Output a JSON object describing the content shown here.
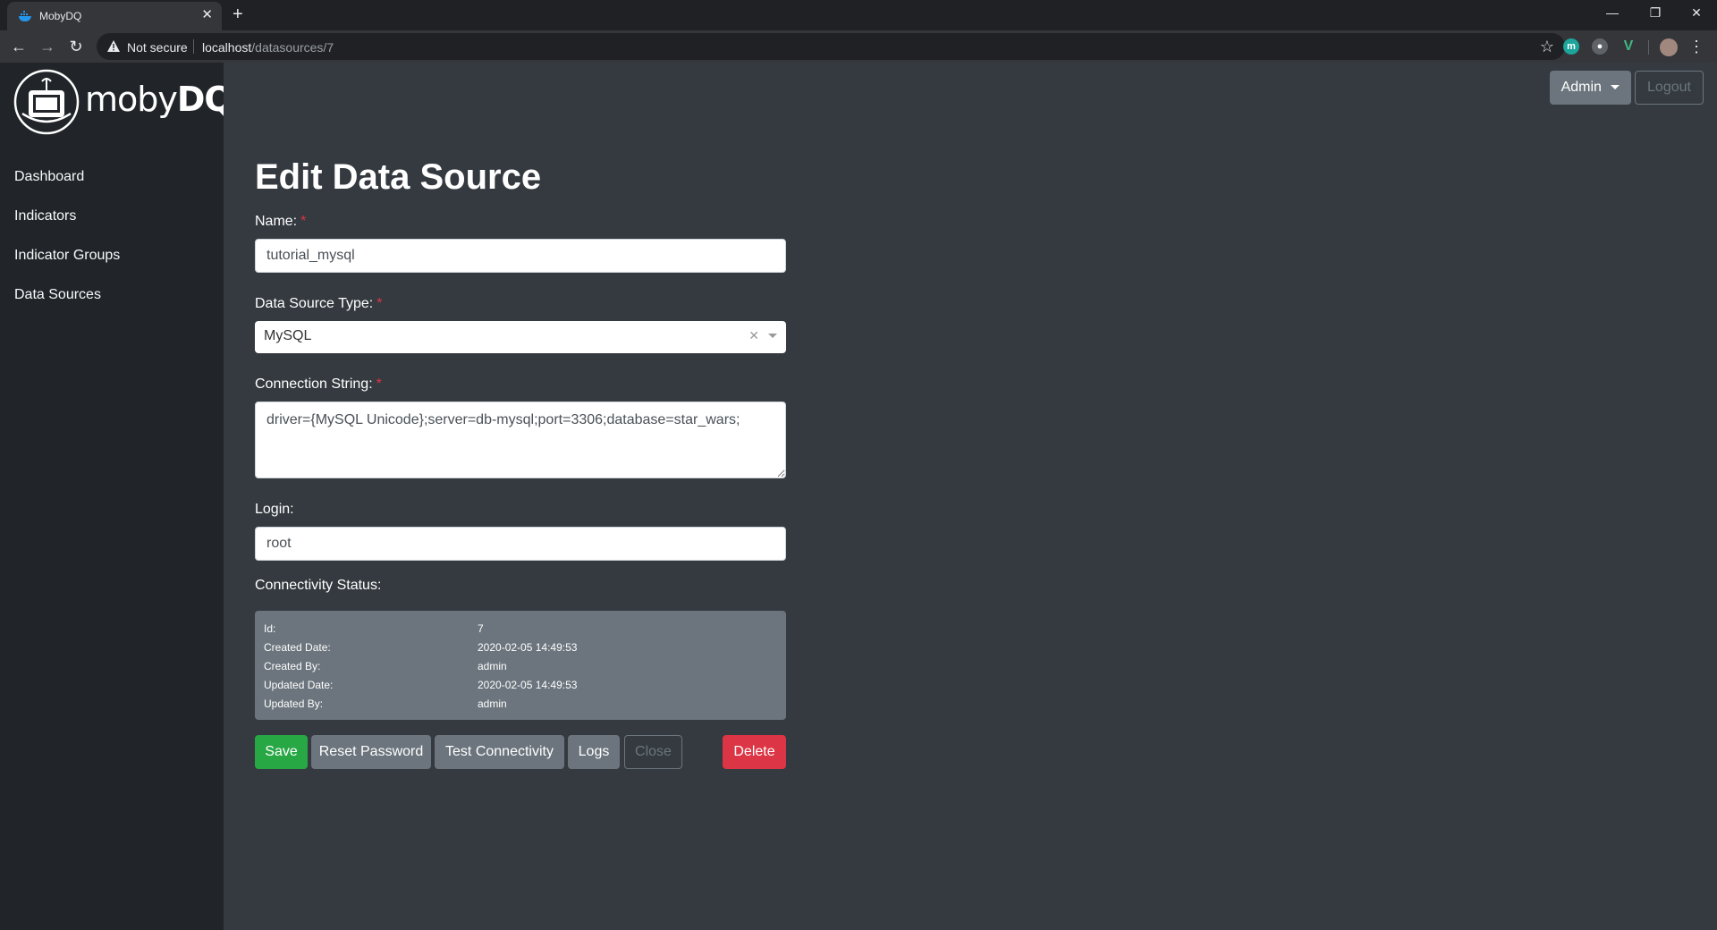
{
  "browser": {
    "tab_title": "MobyDQ",
    "security_label": "Not secure",
    "url_host": "localhost",
    "url_path": "/datasources/7"
  },
  "app": {
    "logo_text_regular": "moby",
    "logo_text_bold": "DQ",
    "nav": [
      {
        "label": "Dashboard"
      },
      {
        "label": "Indicators"
      },
      {
        "label": "Indicator Groups"
      },
      {
        "label": "Data Sources"
      }
    ],
    "header": {
      "user_label": "Admin",
      "logout_label": "Logout"
    }
  },
  "form": {
    "title": "Edit Data Source",
    "name_label": "Name:",
    "name_value": "tutorial_mysql",
    "type_label": "Data Source Type:",
    "type_value": "MySQL",
    "connection_label": "Connection String:",
    "connection_value": "driver={MySQL Unicode};server=db-mysql;port=3306;database=star_wars;",
    "login_label": "Login:",
    "login_value": "root",
    "status_label": "Connectivity Status:",
    "required_mark": "*"
  },
  "status": [
    {
      "key": "Id:",
      "value": "7"
    },
    {
      "key": "Created Date:",
      "value": "2020-02-05 14:49:53"
    },
    {
      "key": "Created By:",
      "value": "admin"
    },
    {
      "key": "Updated Date:",
      "value": "2020-02-05 14:49:53"
    },
    {
      "key": "Updated By:",
      "value": "admin"
    }
  ],
  "actions": {
    "save": "Save",
    "reset_password": "Reset Password",
    "test_connectivity": "Test Connectivity",
    "logs": "Logs",
    "close": "Close",
    "delete": "Delete"
  },
  "colors": {
    "sidebar_bg": "#212529",
    "main_bg": "#343a40",
    "success": "#28a745",
    "danger": "#dc3545",
    "secondary": "#6c757d"
  }
}
